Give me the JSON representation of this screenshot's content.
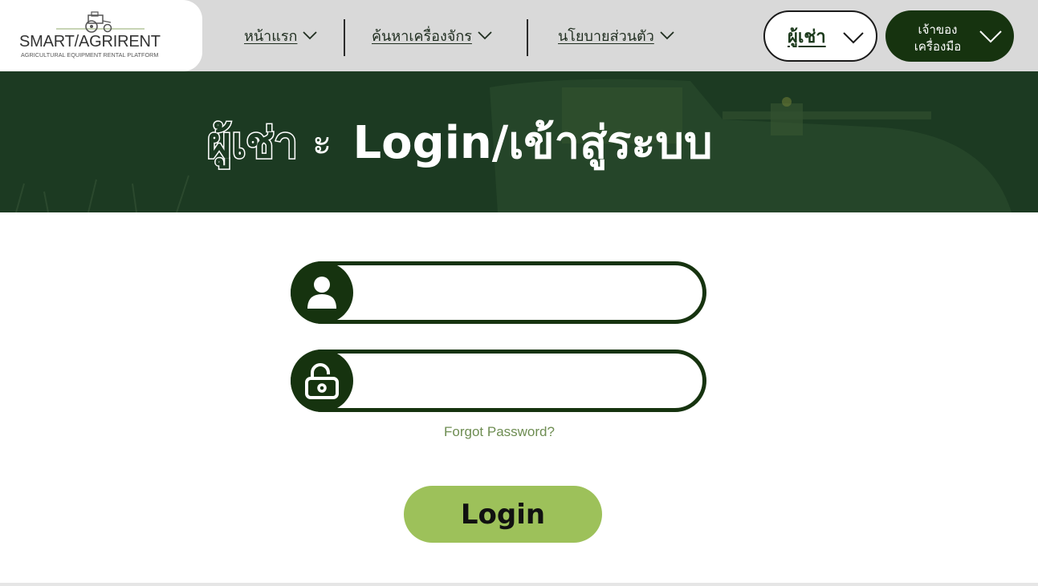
{
  "logo": {
    "name": "SMART/AGRIRENT",
    "tagline": "AGRICULTURAL EQUIPMENT RENTAL PLATFORM"
  },
  "nav": {
    "items": [
      {
        "label": "หน้าแรก",
        "icon": "chevron-down-icon"
      },
      {
        "label": "ค้นหาเครื่องจักร",
        "icon": "chevron-down-icon"
      },
      {
        "label": "นโยบายส่วนตัว",
        "icon": "chevron-down-icon"
      }
    ],
    "role_button": {
      "label": "ผู้เช่า",
      "icon": "chevron-down-icon"
    },
    "owner_button": {
      "line1": "เจ้าของ",
      "line2": "เครื่องมือ",
      "icon": "chevron-down-icon"
    }
  },
  "hero": {
    "role": "ผู้เช่า",
    "separator": "ะ",
    "title": "Login/เข้าสู่ระบบ"
  },
  "form": {
    "username": {
      "value": "",
      "placeholder": "",
      "icon": "user-icon"
    },
    "password": {
      "value": "",
      "placeholder": "",
      "icon": "unlock-icon"
    },
    "forgot_password": "Forgot Password?",
    "login_label": "Login"
  },
  "colors": {
    "dark_green": "#16330f",
    "hero_green": "#1c3a22",
    "accent_green": "#9dc15a",
    "link_green": "#6e8d52",
    "topbar_gray": "#d9d9d9"
  }
}
